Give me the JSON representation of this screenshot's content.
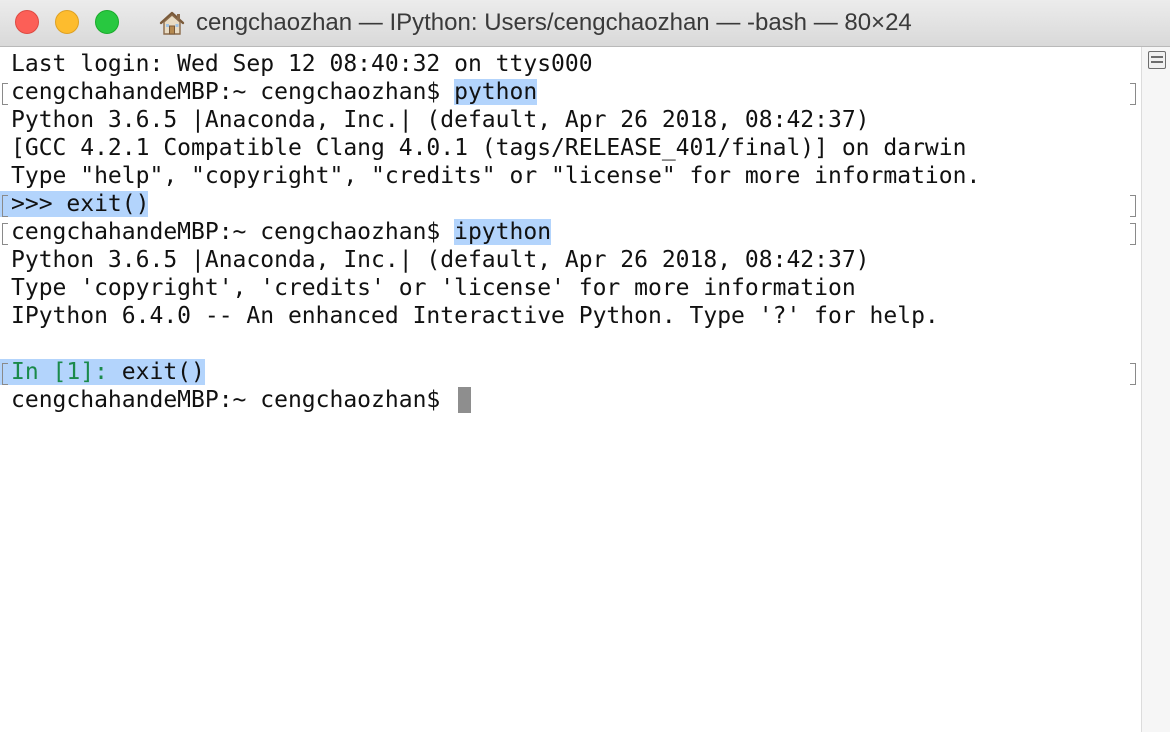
{
  "window": {
    "title": "cengchaozhan — IPython: Users/cengchaozhan — -bash — 80×24",
    "title_icon": "home-icon"
  },
  "colors": {
    "selection": "#b3d4fc",
    "ipython_prompt": "#1a8a4a",
    "close": "#fc5f57",
    "minimize": "#fdbc2e",
    "zoom": "#28c840"
  },
  "terminal": {
    "last_login": "Last login: Wed Sep 12 08:40:32 on ttys000",
    "prompt1": "cengchahandeMBP:~ cengchaozhan$ ",
    "cmd1": "python",
    "py_version": "Python 3.6.5 |Anaconda, Inc.| (default, Apr 26 2018, 08:42:37)",
    "gcc_line": "[GCC 4.2.1 Compatible Clang 4.0.1 (tags/RELEASE_401/final)] on darwin",
    "py_help": "Type \"help\", \"copyright\", \"credits\" or \"license\" for more information.",
    "py_exit": ">>> exit()",
    "prompt2": "cengchahandeMBP:~ cengchaozhan$ ",
    "cmd2": "ipython",
    "ipy_version": "Python 3.6.5 |Anaconda, Inc.| (default, Apr 26 2018, 08:42:37)",
    "ipy_help": "Type 'copyright', 'credits' or 'license' for more information",
    "ipy_banner": "IPython 6.4.0 -- An enhanced Interactive Python. Type '?' for help.",
    "ipy_in_prefix": "In [",
    "ipy_in_num": "1",
    "ipy_in_suffix": "]: ",
    "ipy_exit_cmd": "exit()",
    "prompt3": "cengchahandeMBP:~ cengchaozhan$ "
  }
}
